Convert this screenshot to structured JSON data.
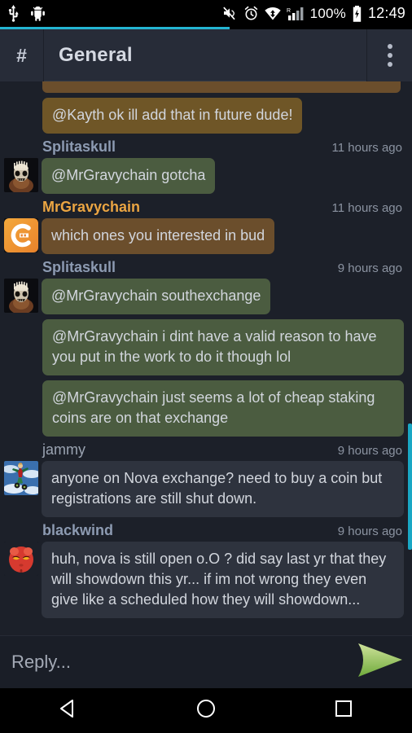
{
  "statusbar": {
    "icons": [
      "usb-icon",
      "android-debug-icon",
      "volume-mute-icon",
      "alarm-icon",
      "wifi-icon",
      "signal-icon"
    ],
    "battery_percent": "100%",
    "battery_icon": "battery-charging-icon",
    "clock": "12:49"
  },
  "appbar": {
    "channel_icon": "#",
    "title": "General",
    "overflow_label": "overflow-menu"
  },
  "colors": {
    "accent": "#23b5d3",
    "scrollbar": "#19a7c4",
    "bubble_brown": "#6f5627",
    "bubble_brown_dark": "#6b4e2c",
    "bubble_green": "#4b5c40",
    "bubble_gray": "#2e333e",
    "author_blue": "#8d9bb2",
    "author_orange": "#eba542",
    "send_green": "#8cc152",
    "background": "#1c2029"
  },
  "messages": [
    {
      "id": "m0",
      "partial": true,
      "author": "",
      "time": "",
      "avatar": "",
      "bubble_style": "brown-dk",
      "text": ""
    },
    {
      "id": "m1",
      "author": "",
      "time": "",
      "avatar": "",
      "bubble_style": "brown",
      "text": "@Kayth ok ill add that in future dude!"
    },
    {
      "id": "m2",
      "author": "Splitaskull",
      "author_color": "blue",
      "time": "11 hours ago",
      "avatar": "skull-warrior-avatar",
      "bubble_style": "green",
      "text": "@MrGravychain gotcha"
    },
    {
      "id": "m3",
      "author": "MrGravychain",
      "author_color": "orange",
      "time": "11 hours ago",
      "avatar": "orange-g-logo-avatar",
      "bubble_style": "brown-dk",
      "text": "which ones you interested in bud"
    },
    {
      "id": "m4",
      "author": "Splitaskull",
      "author_color": "blue",
      "time": "9 hours ago",
      "avatar": "skull-warrior-avatar",
      "bubble_style": "green",
      "text": "@MrGravychain southexchange"
    },
    {
      "id": "m5",
      "author": "",
      "time": "",
      "avatar": "",
      "bubble_style": "green",
      "wide": true,
      "text": "@MrGravychain i dint have a valid reason to have you put in the work to do it though lol"
    },
    {
      "id": "m6",
      "author": "",
      "time": "",
      "avatar": "",
      "bubble_style": "green",
      "wide": true,
      "text": "@MrGravychain just seems a lot of cheap staking coins are on that exchange"
    },
    {
      "id": "m7",
      "author": "jammy",
      "author_color": "plain",
      "time": "9 hours ago",
      "avatar": "skateboarder-sky-avatar",
      "bubble_style": "gray",
      "wide": true,
      "text": "anyone on Nova exchange? need to buy a coin but registrations are still shut down."
    },
    {
      "id": "m8",
      "author": "blackwind",
      "author_color": "blue",
      "time": "9 hours ago",
      "avatar": "red-demon-avatar",
      "bubble_style": "gray",
      "wide": true,
      "text": "huh, nova is still open o.O ? did say  last yr that they will showdown this yr... if im not wrong they even give like a scheduled how they will showdown..."
    }
  ],
  "reply": {
    "placeholder": "Reply...",
    "value": "",
    "send_icon": "send-arrow-icon"
  },
  "navbar": {
    "back_icon": "back-triangle-icon",
    "home_icon": "home-circle-icon",
    "recents_icon": "recents-square-icon"
  }
}
